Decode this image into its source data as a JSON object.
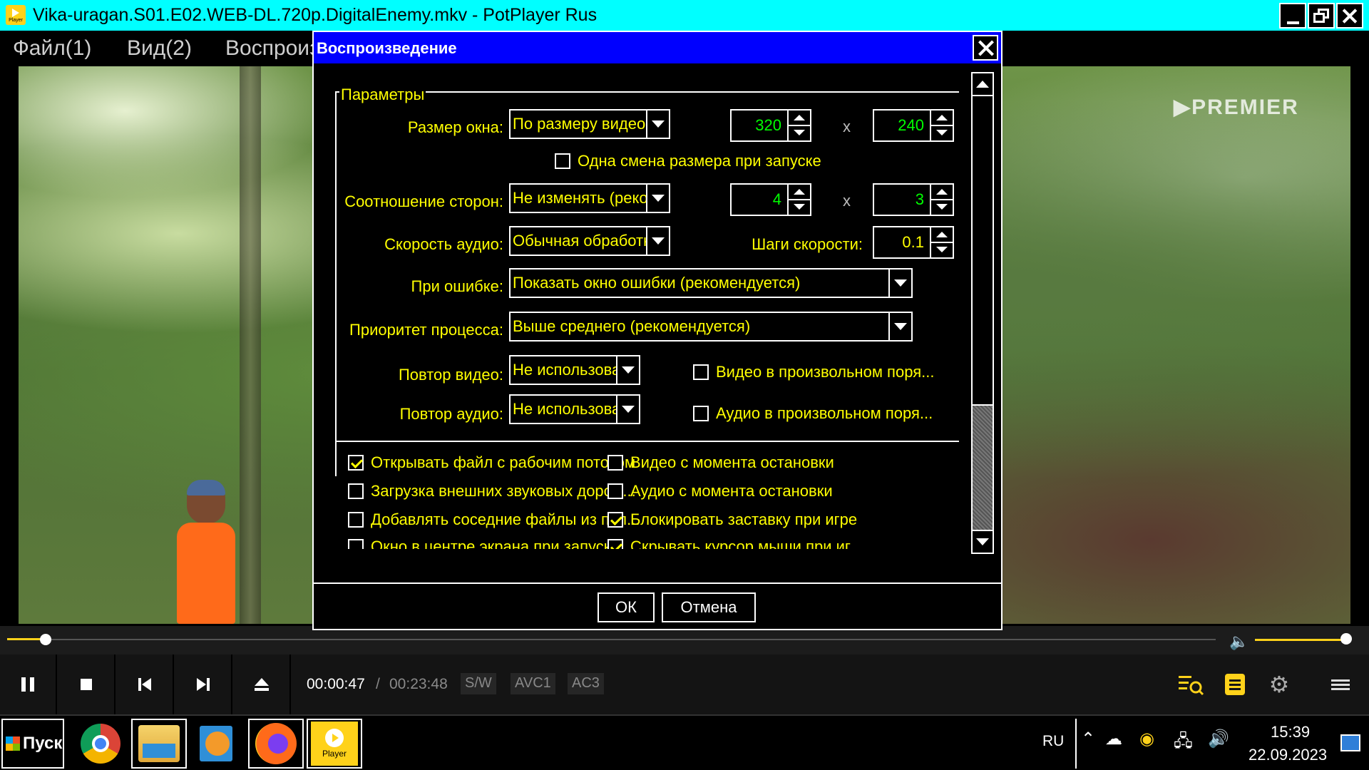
{
  "window": {
    "title": "Vika-uragan.S01.E02.WEB-DL.720p.DigitalEnemy.mkv - PotPlayer Rus",
    "logo_label": "Player"
  },
  "menu": [
    "Файл(1)",
    "Вид(2)",
    "Воспроизведение"
  ],
  "video": {
    "watermark": "▶PREMIER"
  },
  "dialog": {
    "title": "Воспроизведение",
    "group_label": "Параметры",
    "window_size": {
      "label": "Размер окна:",
      "value": "По размеру видео",
      "width": "320",
      "height": "240"
    },
    "resize_once": {
      "label": "Одна смена размера при запуске",
      "checked": false
    },
    "aspect": {
      "label": "Соотношение сторон:",
      "value": "Не изменять (рекомендуется)",
      "x": "4",
      "y": "3"
    },
    "audio_speed": {
      "label": "Скорость аудио:",
      "value": "Обычная обработка",
      "step_label": "Шаги скорости:",
      "step": "0.1"
    },
    "on_error": {
      "label": "При ошибке:",
      "value": "Показать окно ошибки (рекомендуется)"
    },
    "priority": {
      "label": "Приоритет процесса:",
      "value": "Выше среднего (рекомендуется)"
    },
    "repeat_video": {
      "label": "Повтор видео:",
      "value": "Не использовать",
      "shuffle_label": "Видео в произвольном поря...",
      "shuffle_checked": false
    },
    "repeat_audio": {
      "label": "Повтор аудио:",
      "value": "Не использовать",
      "shuffle_label": "Аудио в произвольном поря...",
      "shuffle_checked": false
    },
    "checkboxes_left": [
      {
        "label": "Открывать файл с рабочим потоком",
        "checked": true
      },
      {
        "label": "Загрузка внешних звуковых дорож...",
        "checked": false
      },
      {
        "label": "Добавлять соседние файлы из пап...",
        "checked": false
      },
      {
        "label": "Окно в центре экрана при запуске",
        "checked": false
      }
    ],
    "checkboxes_right": [
      {
        "label": "Видео с момента остановки",
        "checked": false
      },
      {
        "label": "Аудио с момента остановки",
        "checked": false
      },
      {
        "label": "Блокировать заставку при игре",
        "checked": true
      },
      {
        "label": "Скрывать курсор мыши при иг...",
        "checked": true
      }
    ],
    "ok_label": "ОК",
    "cancel_label": "Отмена"
  },
  "player": {
    "seek_fraction": 0.0316,
    "time_current": "00:00:47",
    "time_separator": "/",
    "time_total": "00:23:48",
    "badges": [
      "S/W",
      "AVC1",
      "AC3"
    ],
    "volume_fraction": 0.95
  },
  "taskbar": {
    "start_label": "Пуск",
    "potplayer_label": "Player",
    "language": "RU",
    "time": "15:39",
    "date": "22.09.2023"
  },
  "colors": {
    "title_bar": "#00ffff",
    "dialog_title": "#0000ff",
    "accent": "#ffd21a",
    "dialog_text": "#ffff00",
    "spin_text": "#00ff00"
  }
}
